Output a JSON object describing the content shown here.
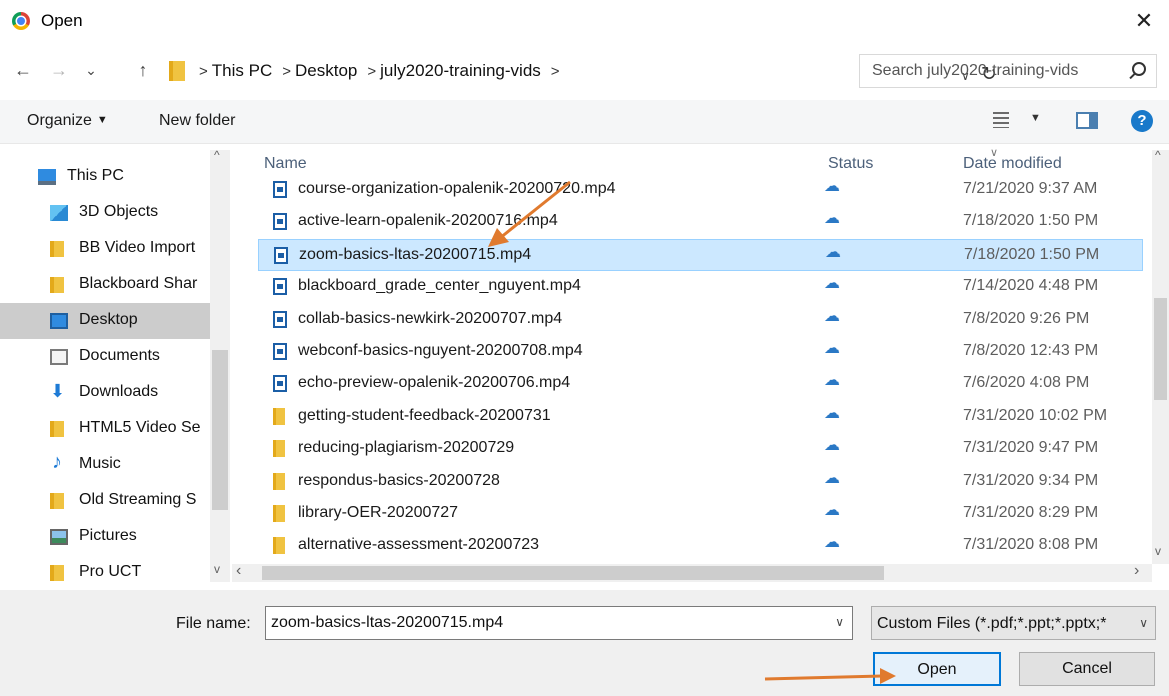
{
  "window": {
    "title": "Open"
  },
  "nav": {
    "back": "←",
    "forward": "→",
    "recent": "⌄",
    "up": "↑",
    "path": [
      "This PC",
      "Desktop",
      "july2020-training-vids"
    ],
    "search_placeholder": "Search july2020-training-vids"
  },
  "toolbar": {
    "organize": "Organize",
    "new_folder": "New folder",
    "help": "?"
  },
  "sidebar": {
    "items": [
      {
        "label": "This PC",
        "icon": "pc-icon"
      },
      {
        "label": "3D Objects",
        "icon": "3d-objects-icon"
      },
      {
        "label": "BB Video Import",
        "icon": "folder-icon"
      },
      {
        "label": "Blackboard Shar",
        "icon": "folder-icon"
      },
      {
        "label": "Desktop",
        "icon": "desktop-icon",
        "selected": true
      },
      {
        "label": "Documents",
        "icon": "documents-icon"
      },
      {
        "label": "Downloads",
        "icon": "downloads-icon"
      },
      {
        "label": "HTML5 Video Se",
        "icon": "folder-icon"
      },
      {
        "label": "Music",
        "icon": "music-icon"
      },
      {
        "label": "Old Streaming S",
        "icon": "folder-icon"
      },
      {
        "label": "Pictures",
        "icon": "pictures-icon"
      },
      {
        "label": "Pro UCT",
        "icon": "folder-icon"
      }
    ]
  },
  "columns": {
    "name": "Name",
    "status": "Status",
    "date": "Date modified"
  },
  "files": [
    {
      "name": "course-organization-opalenik-20200720.mp4",
      "type": "video",
      "status": "cloud",
      "date": "7/21/2020 9:37 AM"
    },
    {
      "name": "active-learn-opalenik-20200716.mp4",
      "type": "video",
      "status": "cloud",
      "date": "7/18/2020 1:50 PM"
    },
    {
      "name": "zoom-basics-ltas-20200715.mp4",
      "type": "video",
      "status": "cloud",
      "date": "7/18/2020 1:50 PM",
      "selected": true
    },
    {
      "name": "blackboard_grade_center_nguyent.mp4",
      "type": "video",
      "status": "cloud",
      "date": "7/14/2020 4:48 PM"
    },
    {
      "name": "collab-basics-newkirk-20200707.mp4",
      "type": "video",
      "status": "cloud",
      "date": "7/8/2020 9:26 PM"
    },
    {
      "name": "webconf-basics-nguyent-20200708.mp4",
      "type": "video",
      "status": "cloud",
      "date": "7/8/2020 12:43 PM"
    },
    {
      "name": "echo-preview-opalenik-20200706.mp4",
      "type": "video",
      "status": "cloud",
      "date": "7/6/2020 4:08 PM"
    },
    {
      "name": "getting-student-feedback-20200731",
      "type": "folder",
      "status": "cloud",
      "date": "7/31/2020 10:02 PM"
    },
    {
      "name": "reducing-plagiarism-20200729",
      "type": "folder",
      "status": "cloud",
      "date": "7/31/2020 9:47 PM"
    },
    {
      "name": "respondus-basics-20200728",
      "type": "folder",
      "status": "cloud",
      "date": "7/31/2020 9:34 PM"
    },
    {
      "name": "library-OER-20200727",
      "type": "folder",
      "status": "cloud",
      "date": "7/31/2020 8:29 PM"
    },
    {
      "name": "alternative-assessment-20200723",
      "type": "folder",
      "status": "cloud",
      "date": "7/31/2020 8:08 PM"
    }
  ],
  "footer": {
    "file_name_label": "File name:",
    "file_name_value": "zoom-basics-ltas-20200715.mp4",
    "filter": "Custom Files (*.pdf;*.ppt;*.pptx;*",
    "open": "Open",
    "cancel": "Cancel"
  },
  "colors": {
    "accent": "#0078d7",
    "selection": "#cce8ff",
    "annotation_arrow": "#e07a2e",
    "cloud": "#2a78c5"
  }
}
